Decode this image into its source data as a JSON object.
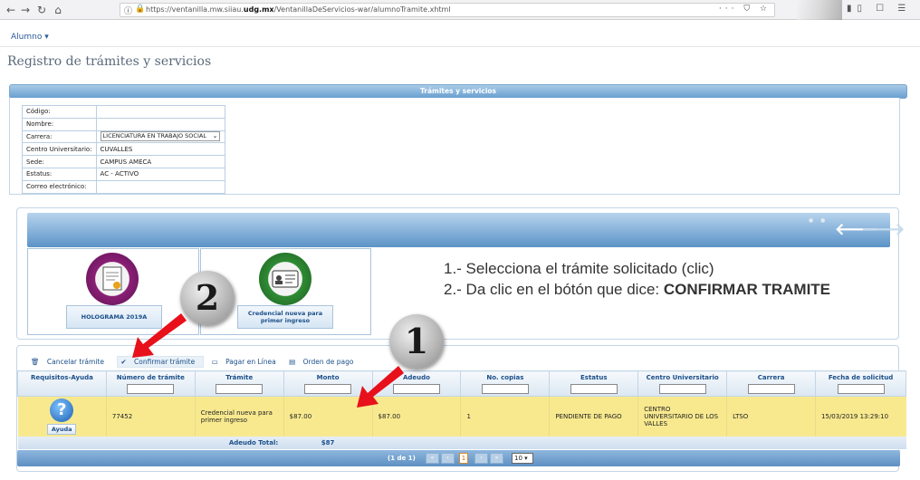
{
  "browser": {
    "url_prefix": "https://ventanilla.mw.siiau.",
    "url_domain": "udg.mx",
    "url_suffix": "/VentanillaDeServicios-war/alumnoTramite.xhtml",
    "url_menu_icons": "··· ⛉ ☆",
    "right_icons": "▮▯ ☐ ☰"
  },
  "header": {
    "menu_label": "Alumno ▾"
  },
  "page_title": "Registro de trámites y servicios",
  "section_title": "Trámites y servicios",
  "student_info": [
    {
      "label": "Código:",
      "value": ""
    },
    {
      "label": "Nombre:",
      "value": ""
    },
    {
      "label": "Carrera:",
      "value": "LICENCIATURA EN TRABAJO SOCIAL"
    },
    {
      "label": "Centro Universitario:",
      "value": "CUVALLES"
    },
    {
      "label": "Sede:",
      "value": "CAMPUS AMECA"
    },
    {
      "label": "Estatus:",
      "value": "AC - ACTIVO"
    },
    {
      "label": "Correo electrónico:",
      "value": ""
    }
  ],
  "carousel": {
    "tiles": [
      {
        "label": "HOLOGRAMA 2019A"
      },
      {
        "label": "Credencial nueva para primer ingreso"
      }
    ],
    "dots": "● ●",
    "prev_arrow": "🡐",
    "next_arrow": "🡒"
  },
  "instructions": {
    "line1": "1.- Selecciona el trámite solicitado (clic)",
    "line2_prefix": "2.- Da clic en el bótón que dice: ",
    "line2_bold": "CONFIRMAR TRAMITE"
  },
  "toolbar": {
    "cancel": "Cancelar trámite",
    "confirm": "Confirmar trámite",
    "pay": "Pagar en Línea",
    "order": "Orden de pago"
  },
  "table": {
    "columns": [
      "Requisitos-Ayuda",
      "Número de trámite",
      "Trámite",
      "Monto",
      "Adeudo",
      "No. copias",
      "Estatus",
      "Centro Universitario",
      "Carrera",
      "Fecha de solicitud"
    ],
    "row": {
      "help_label": "Ayuda",
      "numero": "77452",
      "tramite": "Credencial nueva para primer ingreso",
      "monto": "$87.00",
      "adeudo": "$87.00",
      "copias": "1",
      "estatus": "PENDIENTE DE PAGO",
      "centro": "CENTRO UNIVERSITARIO DE LOS VALLES",
      "carrera": "LTSO",
      "fecha": "15/03/2019 13:29:10"
    },
    "total_label": "Adeudo Total:",
    "total_value": "$87"
  },
  "pager": {
    "info": "(1 de 1)",
    "current": "1",
    "rows": "10 ▾"
  },
  "annotations": {
    "badge1": "1",
    "badge2": "2"
  },
  "colors": {
    "accent_blue": "#5c93c7",
    "row_highlight": "#f8e98f",
    "arrow_red": "#e8101a"
  }
}
